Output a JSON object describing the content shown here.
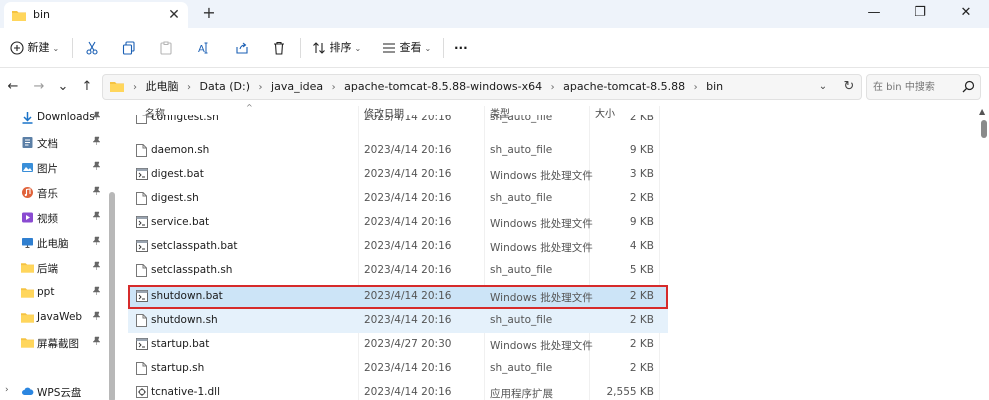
{
  "window": {
    "tab_title": "bin",
    "tab_close": "✕",
    "new_tab": "+",
    "minimize": "—",
    "maximize": "❐",
    "close": "✕"
  },
  "toolbar": {
    "new_label": "新建",
    "sort_label": "排序",
    "view_label": "查看",
    "more": "···"
  },
  "nav": {
    "back": "←",
    "forward": "→",
    "recent": "⌄",
    "up": "↑"
  },
  "address": {
    "crumbs": [
      "此电脑",
      "Data (D:)",
      "java_idea",
      "apache-tomcat-8.5.88-windows-x64",
      "apache-tomcat-8.5.88",
      "bin"
    ],
    "separator": "›",
    "dropdown": "⌄",
    "refresh": "↻"
  },
  "search": {
    "placeholder": "在 bin 中搜索"
  },
  "sidebar": {
    "items": [
      {
        "label": "Downloads",
        "icon": "download-icon",
        "pinned": true
      },
      {
        "label": "文档",
        "icon": "document-icon",
        "pinned": true
      },
      {
        "label": "图片",
        "icon": "picture-icon",
        "pinned": true
      },
      {
        "label": "音乐",
        "icon": "music-icon",
        "pinned": true
      },
      {
        "label": "视频",
        "icon": "video-icon",
        "pinned": true
      },
      {
        "label": "此电脑",
        "icon": "computer-icon",
        "pinned": true
      },
      {
        "label": "后端",
        "icon": "folder-icon",
        "pinned": true
      },
      {
        "label": "ppt",
        "icon": "folder-icon",
        "pinned": true
      },
      {
        "label": "JavaWeb",
        "icon": "folder-icon",
        "pinned": true
      },
      {
        "label": "屏幕截图",
        "icon": "folder-icon",
        "pinned": true
      },
      {
        "label": "WPS云盘",
        "icon": "cloud-icon",
        "pinned": false
      }
    ],
    "pin_glyph": "📌",
    "expand_glyph": "›"
  },
  "columns": {
    "name": "名称",
    "date": "修改日期",
    "type": "类型",
    "size": "大小"
  },
  "files": [
    {
      "name": "configtest.sh",
      "date": "2023/4/14 20:16",
      "type": "sh_auto_file",
      "size": "2 KB",
      "icon": "file-icon"
    },
    {
      "name": "daemon.sh",
      "date": "2023/4/14 20:16",
      "type": "sh_auto_file",
      "size": "9 KB",
      "icon": "file-icon"
    },
    {
      "name": "digest.bat",
      "date": "2023/4/14 20:16",
      "type": "Windows 批处理文件",
      "size": "3 KB",
      "icon": "batch-file-icon"
    },
    {
      "name": "digest.sh",
      "date": "2023/4/14 20:16",
      "type": "sh_auto_file",
      "size": "2 KB",
      "icon": "file-icon"
    },
    {
      "name": "service.bat",
      "date": "2023/4/14 20:16",
      "type": "Windows 批处理文件",
      "size": "9 KB",
      "icon": "batch-file-icon"
    },
    {
      "name": "setclasspath.bat",
      "date": "2023/4/14 20:16",
      "type": "Windows 批处理文件",
      "size": "4 KB",
      "icon": "batch-file-icon"
    },
    {
      "name": "setclasspath.sh",
      "date": "2023/4/14 20:16",
      "type": "sh_auto_file",
      "size": "5 KB",
      "icon": "file-icon"
    },
    {
      "name": "shutdown.bat",
      "date": "2023/4/14 20:16",
      "type": "Windows 批处理文件",
      "size": "2 KB",
      "icon": "batch-file-icon",
      "state": "selected"
    },
    {
      "name": "shutdown.sh",
      "date": "2023/4/14 20:16",
      "type": "sh_auto_file",
      "size": "2 KB",
      "icon": "file-icon",
      "state": "hover"
    },
    {
      "name": "startup.bat",
      "date": "2023/4/27 20:30",
      "type": "Windows 批处理文件",
      "size": "2 KB",
      "icon": "batch-file-icon"
    },
    {
      "name": "startup.sh",
      "date": "2023/4/14 20:16",
      "type": "sh_auto_file",
      "size": "2 KB",
      "icon": "file-icon"
    },
    {
      "name": "tcnative-1.dll",
      "date": "2023/4/14 20:16",
      "type": "应用程序扩展",
      "size": "2,555 KB",
      "icon": "dll-file-icon"
    }
  ],
  "colors": {
    "accent": "#0067c0",
    "selected_row": "#cce4f7",
    "hover_row": "#e5f1fb",
    "highlight_box": "#d62b2b",
    "folder": "#f5c342"
  }
}
